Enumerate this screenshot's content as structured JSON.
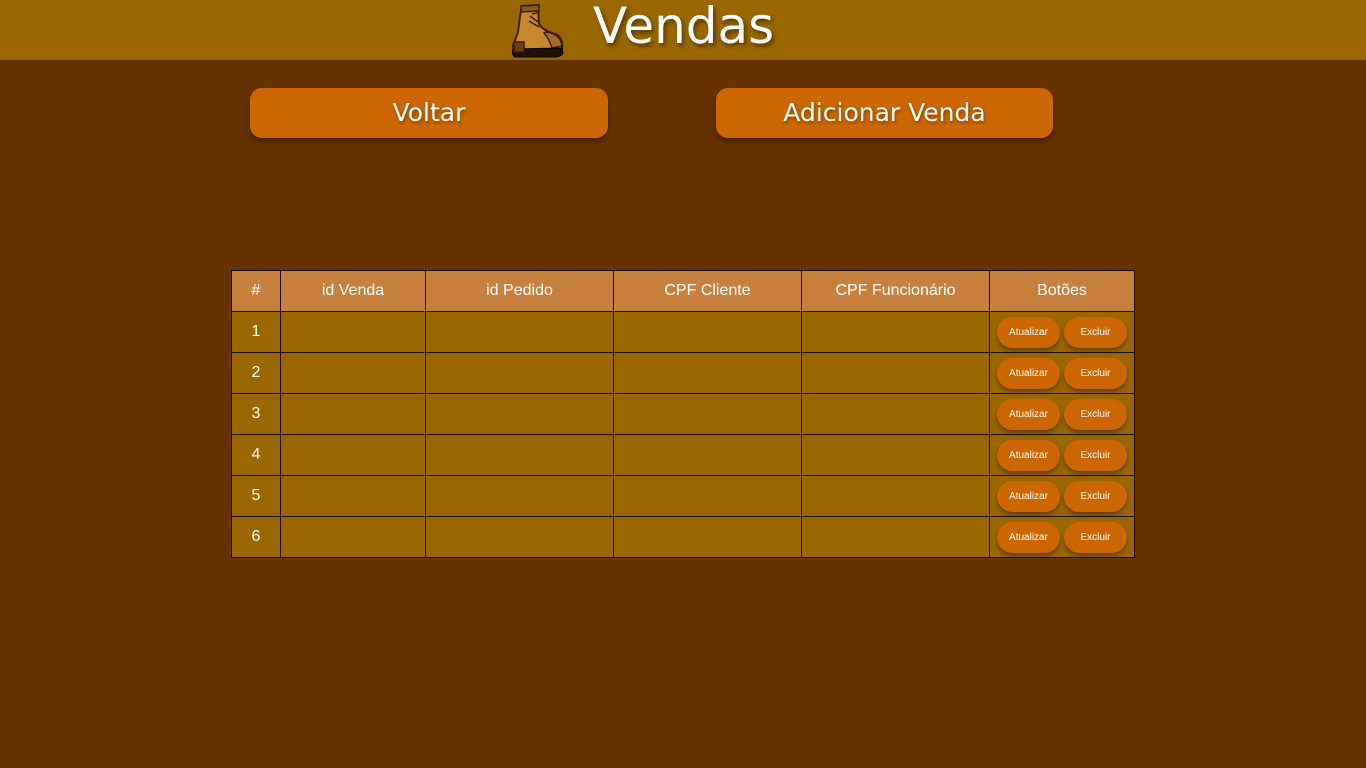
{
  "header": {
    "title": "Vendas",
    "logo_icon": "boot-icon"
  },
  "actions": {
    "back_label": "Voltar",
    "add_label": "Adicionar Venda"
  },
  "table": {
    "columns": [
      "#",
      "id Venda",
      "id Pedido",
      "CPF Cliente",
      "CPF Funcionário",
      "Botões"
    ],
    "rows": [
      {
        "num": "1",
        "id_venda": "",
        "id_pedido": "",
        "cpf_cliente": "",
        "cpf_funcionario": "",
        "update_label": "Atualizar",
        "delete_label": "Excluir"
      },
      {
        "num": "2",
        "id_venda": "",
        "id_pedido": "",
        "cpf_cliente": "",
        "cpf_funcionario": "",
        "update_label": "Atualizar",
        "delete_label": "Excluir"
      },
      {
        "num": "3",
        "id_venda": "",
        "id_pedido": "",
        "cpf_cliente": "",
        "cpf_funcionario": "",
        "update_label": "Atualizar",
        "delete_label": "Excluir"
      },
      {
        "num": "4",
        "id_venda": "",
        "id_pedido": "",
        "cpf_cliente": "",
        "cpf_funcionario": "",
        "update_label": "Atualizar",
        "delete_label": "Excluir"
      },
      {
        "num": "5",
        "id_venda": "",
        "id_pedido": "",
        "cpf_cliente": "",
        "cpf_funcionario": "",
        "update_label": "Atualizar",
        "delete_label": "Excluir"
      },
      {
        "num": "6",
        "id_venda": "",
        "id_pedido": "",
        "cpf_cliente": "",
        "cpf_funcionario": "",
        "update_label": "Atualizar",
        "delete_label": "Excluir"
      }
    ]
  },
  "colors": {
    "page_bg": "#663300",
    "header_bg": "#996600",
    "button_bg": "#cc6600",
    "table_header_bg": "#c8803f",
    "table_cell_bg": "#996600"
  }
}
